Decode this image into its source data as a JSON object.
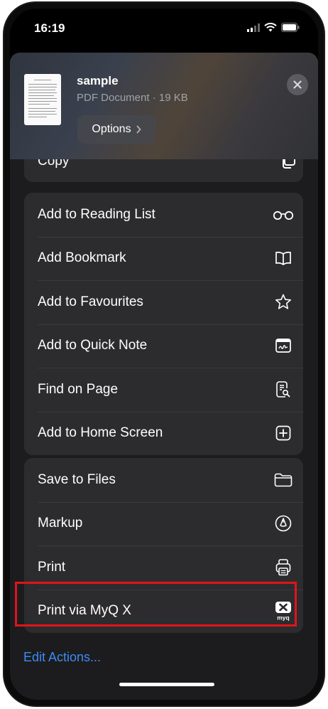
{
  "status": {
    "time": "16:19"
  },
  "document": {
    "title": "sample",
    "meta": "PDF Document · 19 KB",
    "options_label": "Options"
  },
  "copy_label": "Copy",
  "group_main": [
    {
      "label": "Add to Reading List",
      "icon": "glasses-icon"
    },
    {
      "label": "Add Bookmark",
      "icon": "book-icon"
    },
    {
      "label": "Add to Favourites",
      "icon": "star-icon"
    },
    {
      "label": "Add to Quick Note",
      "icon": "quick-note-icon"
    },
    {
      "label": "Find on Page",
      "icon": "find-document-icon"
    },
    {
      "label": "Add to Home Screen",
      "icon": "plus-square-icon"
    }
  ],
  "group_actions": [
    {
      "label": "Save to Files",
      "icon": "folder-icon"
    },
    {
      "label": "Markup",
      "icon": "markup-pen-icon"
    },
    {
      "label": "Print",
      "icon": "printer-icon"
    },
    {
      "label": "Print via MyQ X",
      "icon": "myq-x-icon",
      "icon_text": "myq"
    }
  ],
  "edit_actions": "Edit Actions...",
  "colors": {
    "highlight": "#e0141b",
    "link": "#3d8bf2",
    "sheet": "#1c1c1e",
    "row": "#2c2c2e"
  }
}
